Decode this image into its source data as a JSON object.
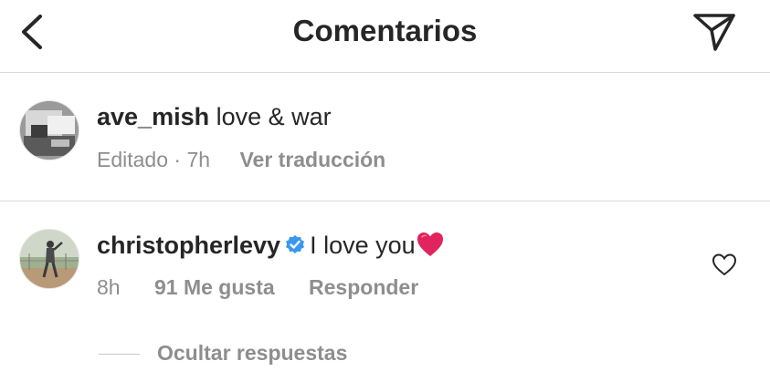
{
  "header": {
    "title": "Comentarios",
    "back_icon": "chevron-left-icon",
    "send_icon": "paper-plane-icon"
  },
  "comments": [
    {
      "username": "ave_mish",
      "text": "love & war",
      "edited_label": "Editado",
      "separator": "·",
      "time": "7h",
      "translate_label": "Ver traducción"
    },
    {
      "username": "christopherlevy",
      "verified": true,
      "text": "I love you",
      "emoji": "red-heart",
      "time": "8h",
      "likes_label": "91 Me gusta",
      "reply_label": "Responder",
      "like_icon": "heart-outline-icon",
      "hide_replies_label": "Ocultar respuestas"
    }
  ],
  "colors": {
    "text": "#262626",
    "secondary": "#8e8e8e",
    "divider": "#dbdbdb",
    "verified": "#3897f0",
    "heart": "#e0245e"
  }
}
